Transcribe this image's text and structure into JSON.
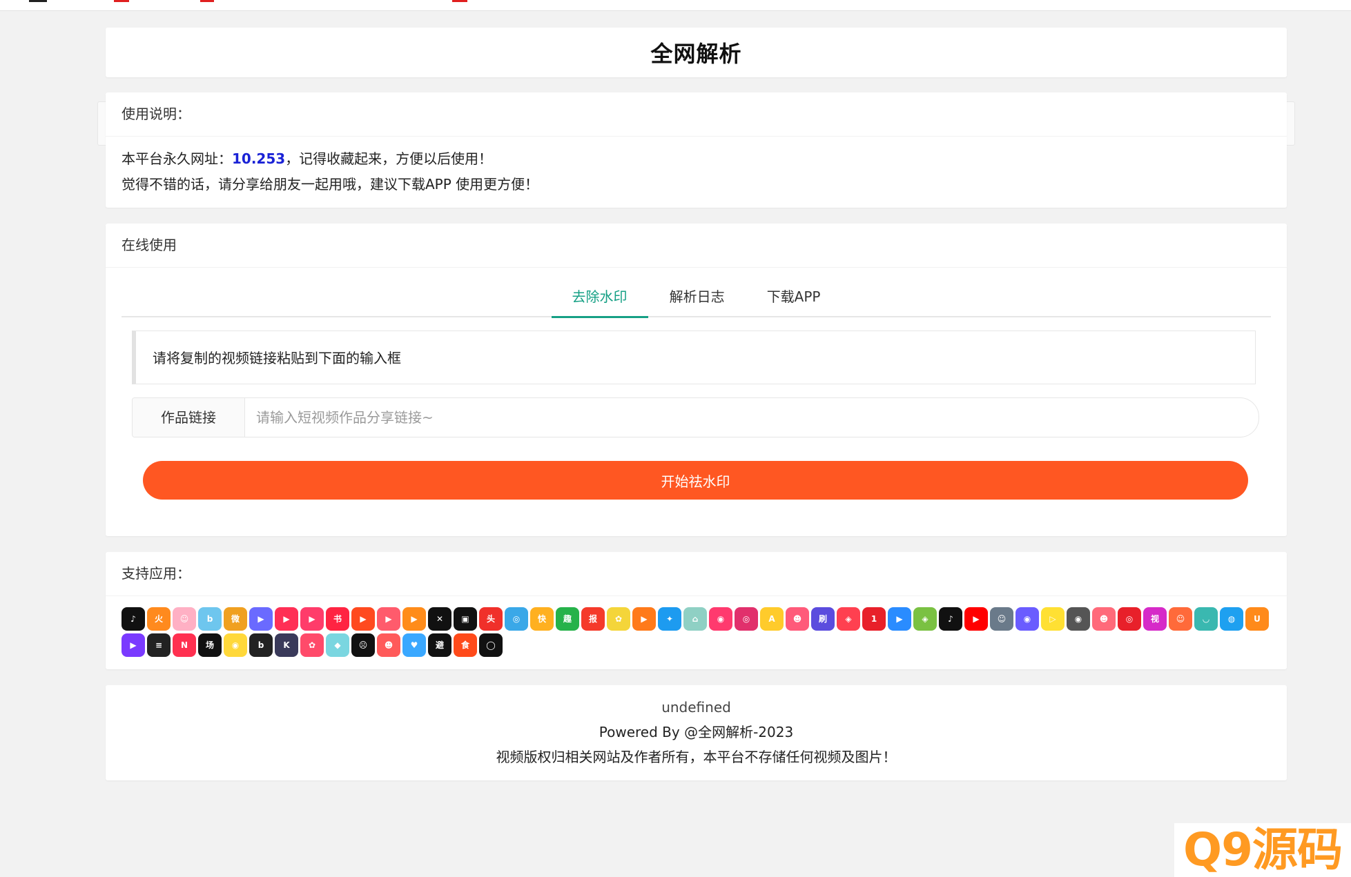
{
  "title": "全网解析",
  "notice": {
    "header": "使用说明：",
    "line1_prefix": "本平台永久网址：",
    "line1_url": "10.253",
    "line1_suffix": "，记得收藏起来，方便以后使用！",
    "line2": "觉得不错的话，请分享给朋友一起用哦，建议下载APP 使用更方便！"
  },
  "online": {
    "header": "在线使用",
    "tabs": [
      {
        "label": "去除水印",
        "active": true
      },
      {
        "label": "解析日志",
        "active": false
      },
      {
        "label": "下载APP",
        "active": false
      }
    ],
    "tip": "请将复制的视频链接粘贴到下面的输入框",
    "input_label": "作品链接",
    "input_placeholder": "请输入短视频作品分享链接~",
    "input_value": "",
    "button_label": "开始祛水印"
  },
  "apps": {
    "header": "支持应用：",
    "icons": [
      {
        "name": "douyin-app-icon",
        "color": "#111111",
        "glyph": "♪"
      },
      {
        "name": "huoshan-app-icon",
        "color": "#ff8a1e",
        "glyph": "火"
      },
      {
        "name": "kuaishou-gif-app-icon",
        "color": "#ffb0c4",
        "glyph": "☺"
      },
      {
        "name": "bilibili-app-icon",
        "color": "#6ec6ee",
        "glyph": "b"
      },
      {
        "name": "weibo-app-icon",
        "color": "#f0a020",
        "glyph": "微"
      },
      {
        "name": "xigua-app-icon",
        "color": "#6a6aff",
        "glyph": "▶"
      },
      {
        "name": "zuiyou-app-icon",
        "color": "#ff2f55",
        "glyph": "▶"
      },
      {
        "name": "weishi-app-icon",
        "color": "#ff3c6a",
        "glyph": "▶"
      },
      {
        "name": "xiaohongshu-app-icon",
        "color": "#ff2442",
        "glyph": "书"
      },
      {
        "name": "kuai-video-app-icon",
        "color": "#ff4a1f",
        "glyph": "▶"
      },
      {
        "name": "haokan-app-icon",
        "color": "#ff5b6c",
        "glyph": "▶"
      },
      {
        "name": "quanmin-app-icon",
        "color": "#ff8c1a",
        "glyph": "▶"
      },
      {
        "name": "capcut-app-icon",
        "color": "#111111",
        "glyph": "✕"
      },
      {
        "name": "huya-app-icon",
        "color": "#111111",
        "glyph": "▣"
      },
      {
        "name": "toutiao-app-icon",
        "color": "#f0302a",
        "glyph": "头"
      },
      {
        "name": "lvzhou-app-icon",
        "color": "#3aa8e8",
        "glyph": "◎"
      },
      {
        "name": "kuai-text-app-icon",
        "color": "#ffb020",
        "glyph": "快"
      },
      {
        "name": "qutoutiao-app-icon",
        "color": "#26b24a",
        "glyph": "趣"
      },
      {
        "name": "kuaibao-app-icon",
        "color": "#f53a2a",
        "glyph": "报"
      },
      {
        "name": "pipixia-app-icon",
        "color": "#f4d53a",
        "glyph": "✿"
      },
      {
        "name": "miaopai-app-icon",
        "color": "#ff7a1a",
        "glyph": "▶"
      },
      {
        "name": "twitter-app-icon",
        "color": "#1d9bf0",
        "glyph": "✦"
      },
      {
        "name": "landscape-app-icon",
        "color": "#8fd0c4",
        "glyph": "⌂"
      },
      {
        "name": "meipai-app-icon",
        "color": "#ff3a6e",
        "glyph": "◉"
      },
      {
        "name": "instagram-app-icon",
        "color": "#e1306c",
        "glyph": "◎"
      },
      {
        "name": "acfun-app-icon",
        "color": "#ffcb2b",
        "glyph": "A"
      },
      {
        "name": "face-app-icon",
        "color": "#ff5a7a",
        "glyph": "☻"
      },
      {
        "name": "shua-app-icon",
        "color": "#5b4cde",
        "glyph": "刷"
      },
      {
        "name": "live-app-icon",
        "color": "#ff4050",
        "glyph": "◈"
      },
      {
        "name": "yizhibo-app-icon",
        "color": "#e8202a",
        "glyph": "1"
      },
      {
        "name": "youku-app-icon",
        "color": "#2a8cff",
        "glyph": "▶"
      },
      {
        "name": "iqiyi-app-icon",
        "color": "#7ac142",
        "glyph": "◈"
      },
      {
        "name": "tiktok-app-icon",
        "color": "#111111",
        "glyph": "♪"
      },
      {
        "name": "youtube-app-icon",
        "color": "#ff0000",
        "glyph": "▶"
      },
      {
        "name": "cartoon-app-icon",
        "color": "#6a7a8a",
        "glyph": "☺"
      },
      {
        "name": "chat-app-icon",
        "color": "#6a5cff",
        "glyph": "◉"
      },
      {
        "name": "pear-app-icon",
        "color": "#ffe033",
        "glyph": "▷"
      },
      {
        "name": "camera-app-icon",
        "color": "#555555",
        "glyph": "◉"
      },
      {
        "name": "portrait-app-icon",
        "color": "#ff6a7a",
        "glyph": "☻"
      },
      {
        "name": "netease-app-icon",
        "color": "#e8202a",
        "glyph": "◎"
      },
      {
        "name": "shipin-app-icon",
        "color": "#d62ac8",
        "glyph": "视"
      },
      {
        "name": "anime-app-icon",
        "color": "#ff6a3a",
        "glyph": "☺"
      },
      {
        "name": "bowl-app-icon",
        "color": "#3ab8b0",
        "glyph": "◡"
      },
      {
        "name": "qq-app-icon",
        "color": "#1ea0f0",
        "glyph": "◍"
      },
      {
        "name": "uc-app-icon",
        "color": "#ff8a1a",
        "glyph": "U"
      },
      {
        "name": "purple-play-app-icon",
        "color": "#7a3aff",
        "glyph": "▶"
      },
      {
        "name": "stripes-app-icon",
        "color": "#222222",
        "glyph": "≡"
      },
      {
        "name": "new-app-icon",
        "color": "#ff3050",
        "glyph": "N"
      },
      {
        "name": "changku-app-icon",
        "color": "#111111",
        "glyph": "场"
      },
      {
        "name": "yellow-eye-app-icon",
        "color": "#ffd83a",
        "glyph": "◉"
      },
      {
        "name": "b-app-icon",
        "color": "#222222",
        "glyph": "b"
      },
      {
        "name": "k-app-icon",
        "color": "#3a3a5a",
        "glyph": "K"
      },
      {
        "name": "colorful-app-icon",
        "color": "#ff4a6a",
        "glyph": "✿"
      },
      {
        "name": "gradient-app-icon",
        "color": "#7ad6e0",
        "glyph": "◆"
      },
      {
        "name": "scream-app-icon",
        "color": "#111111",
        "glyph": "☹"
      },
      {
        "name": "monkey-app-icon",
        "color": "#ff5a5a",
        "glyph": "☻"
      },
      {
        "name": "heart-app-icon",
        "color": "#3aa8ff",
        "glyph": "♥"
      },
      {
        "name": "biyou-app-icon",
        "color": "#111111",
        "glyph": "避"
      },
      {
        "name": "shi-app-icon",
        "color": "#ff4a1a",
        "glyph": "食"
      },
      {
        "name": "ring-app-icon",
        "color": "#111111",
        "glyph": "◯"
      }
    ]
  },
  "footer": {
    "line1": "undefined",
    "line2": "Powered By @全网解析-2023",
    "line3": "视频版权归相关网站及作者所有，本平台不存储任何视频及图片！"
  },
  "watermark": "Q9源码"
}
